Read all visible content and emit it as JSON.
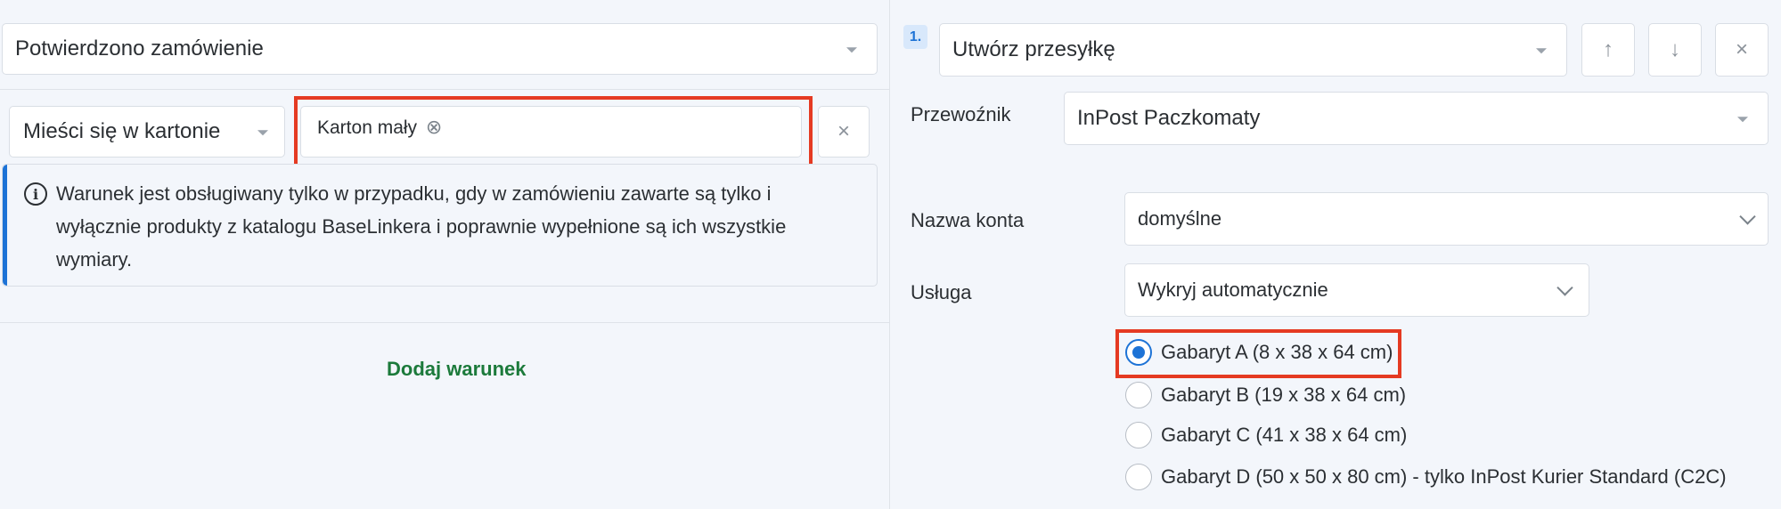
{
  "left": {
    "trigger_select": "Potwierdzono zamówienie",
    "condition_select": "Mieści się w kartonie",
    "condition_value_tag": "Karton mały",
    "tag_remove_icon": "⊗",
    "remove_condition_label": "×",
    "info_icon_glyph": "i",
    "info_lines": [
      "Warunek jest obsługiwany tylko w przypadku, gdy w zamówieniu zawarte są tylko i",
      "wyłącznie produkty z katalogu BaseLinkera i poprawnie wypełnione są ich wszystkie",
      "wymiary."
    ],
    "add_condition": "Dodaj warunek"
  },
  "right": {
    "step_number": "1.",
    "action_select": "Utwórz przesyłkę",
    "up_arrow": "↑",
    "down_arrow": "↓",
    "close": "×",
    "carrier_label": "Przewoźnik",
    "carrier_value": "InPost Paczkomaty",
    "account_label": "Nazwa konta",
    "account_value": "domyślne",
    "service_label": "Usługa",
    "service_value": "Wykryj automatycznie",
    "size_options": [
      {
        "label": "Gabaryt A (8 x 38 x 64 cm)",
        "checked": true
      },
      {
        "label": "Gabaryt B (19 x 38 x 64 cm)",
        "checked": false
      },
      {
        "label": "Gabaryt C (41 x 38 x 64 cm)",
        "checked": false
      },
      {
        "label": "Gabaryt D (50 x 50 x 80 cm) - tylko InPost Kurier Standard (C2C)",
        "checked": false
      }
    ]
  },
  "colors": {
    "highlight": "#e53a22",
    "accent": "#1d73d6",
    "link_green": "#1c7a3b"
  }
}
